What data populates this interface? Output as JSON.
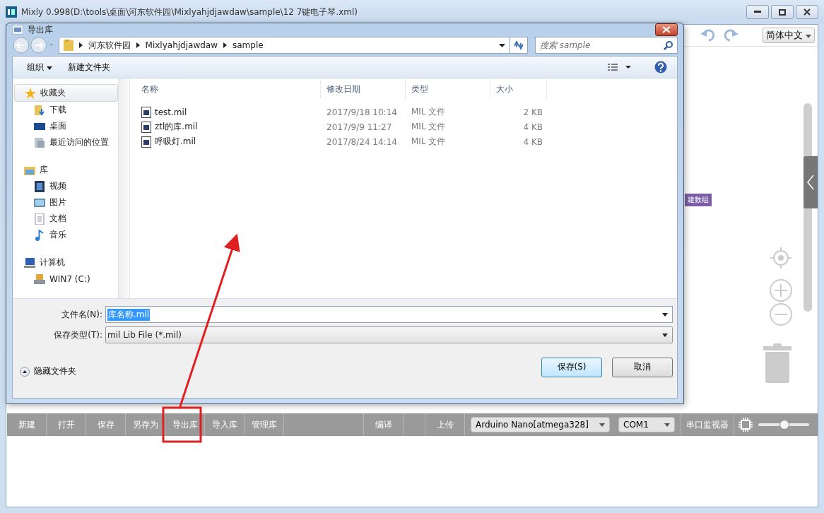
{
  "window": {
    "title": "Mixly 0.998(D:\\tools\\桌面\\河东软件园\\Mixlyahjdjawdaw\\sample\\12 7键电子琴.xml)"
  },
  "top_toolbar": {
    "language": "简体中文"
  },
  "workspace": {
    "block_label": "建数组"
  },
  "dialog": {
    "title": "导出库",
    "breadcrumb": [
      "河东软件园",
      "Mixlyahjdjawdaw",
      "sample"
    ],
    "search": {
      "placeholder": "搜索 sample"
    },
    "organize": "组织",
    "new_folder": "新建文件夹",
    "nav": [
      {
        "label": "收藏夹",
        "selected": true,
        "children": [
          {
            "label": "下载",
            "selected": false
          },
          {
            "label": "桌面",
            "selected": false
          },
          {
            "label": "最近访问的位置",
            "selected": false
          }
        ]
      },
      {
        "label": "库",
        "selected": false,
        "children": [
          {
            "label": "视频",
            "selected": false
          },
          {
            "label": "图片",
            "selected": false
          },
          {
            "label": "文档",
            "selected": false
          },
          {
            "label": "音乐",
            "selected": false
          }
        ]
      },
      {
        "label": "计算机",
        "selected": false,
        "children": [
          {
            "label": "WIN7 (C:)",
            "selected": false
          }
        ]
      }
    ],
    "columns": [
      "名称",
      "修改日期",
      "类型",
      "大小"
    ],
    "rows": [
      {
        "name": "test.mil",
        "date": "2017/9/18 10:14",
        "type": "MIL 文件",
        "size": "2 KB"
      },
      {
        "name": "ztl的库.mil",
        "date": "2017/9/9 11:27",
        "type": "MIL 文件",
        "size": "4 KB"
      },
      {
        "name": "呼吸灯.mil",
        "date": "2017/8/24 14:14",
        "type": "MIL 文件",
        "size": "4 KB"
      }
    ],
    "file_name": {
      "label": "文件名(N):",
      "value": "库名称.mil"
    },
    "file_type": {
      "label": "保存类型(T):",
      "value": "mil Lib File (*.mil)"
    },
    "hide_folders": "隐藏文件夹",
    "buttons": [
      "保存(S)",
      "取消"
    ]
  },
  "bottom_toolbar": {
    "buttons": [
      {
        "label": "新建",
        "kind": "button"
      },
      {
        "label": "打开",
        "kind": "button"
      },
      {
        "label": "保存",
        "kind": "button"
      },
      {
        "label": "另存为",
        "kind": "button"
      },
      {
        "label": "导出库",
        "kind": "button"
      },
      {
        "label": "导入库",
        "kind": "button"
      },
      {
        "label": "管理库",
        "kind": "button"
      },
      {
        "kind": "spacer"
      },
      {
        "label": "编译",
        "kind": "button"
      },
      {
        "kind": "gap"
      },
      {
        "label": "上传",
        "kind": "button"
      }
    ],
    "board": "Arduino Nano[atmega328]",
    "port": "COM1",
    "monitor": "串口监视器",
    "slider": {
      "level": 0.5
    }
  }
}
